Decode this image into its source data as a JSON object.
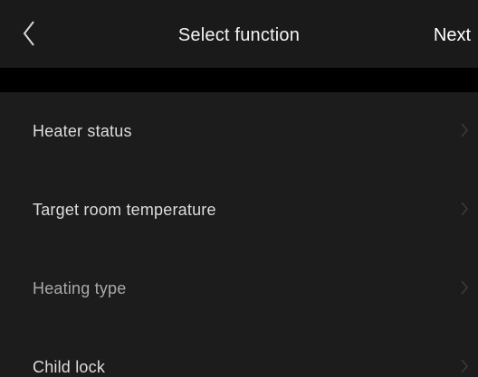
{
  "header": {
    "title": "Select function",
    "next_label": "Next",
    "back_icon": "chevron-left-icon"
  },
  "functions": [
    {
      "label": "Heater status",
      "icon": "chevron-right-icon"
    },
    {
      "label": "Target room temperature",
      "icon": "chevron-right-icon"
    },
    {
      "label": "Heating type",
      "icon": "chevron-right-icon"
    },
    {
      "label": "Child lock",
      "icon": "chevron-right-icon"
    }
  ],
  "colors": {
    "background": "#171717",
    "list_background": "#1c1c1c",
    "separator_band": "#000000",
    "text": "#ffffff",
    "chevron": "#3a3a3a"
  }
}
